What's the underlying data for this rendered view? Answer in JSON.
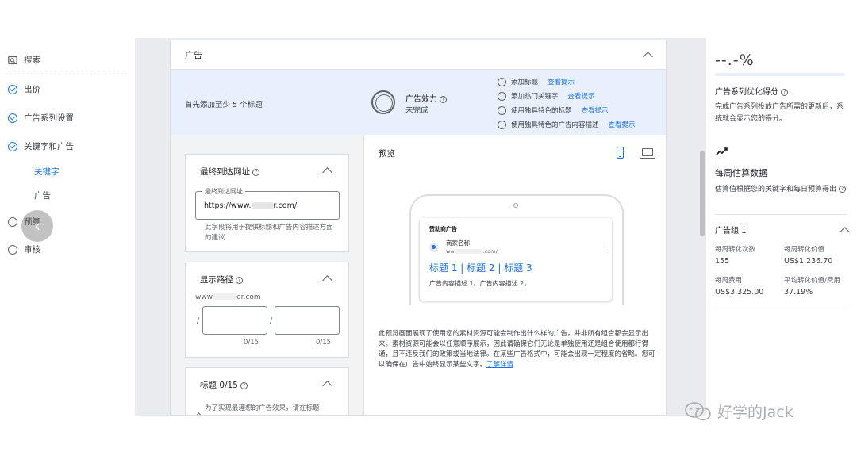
{
  "nav": {
    "search": "搜索",
    "bidding": "出价",
    "campaign_settings": "广告系列设置",
    "keywords_ads": "关键字和广告",
    "keywords": "关键字",
    "ads": "广告",
    "budget": "预算",
    "review": "审核"
  },
  "card": {
    "title": "广告",
    "banner_text": "首先添加至少 5 个标题",
    "ad_strength_label": "广告效力",
    "ad_strength_status": "未完成",
    "tips": [
      {
        "text": "添加标题",
        "link": "查看提示"
      },
      {
        "text": "添加热门关键字",
        "link": "查看提示"
      },
      {
        "text": "使用独具特色的标题",
        "link": "查看提示"
      },
      {
        "text": "使用独具特色的广告内容描述",
        "link": "查看提示"
      }
    ]
  },
  "form": {
    "final_url_title": "最终到达网址",
    "final_url_label": "最终到达网址",
    "final_url_prefix": "https://www.",
    "final_url_suffix": "r.com/",
    "final_url_hint": "此字段将用于提供标题和广告内容描述方面的建议",
    "display_path_title": "显示路径",
    "display_domain_prefix": "www",
    "display_domain_suffix": "er.com",
    "path_slash": "/",
    "path1_count": "0/15",
    "path2_count": "0/15",
    "headline_title": "标题 0/15",
    "headline_hint": "为了实现最理想的广告效果，请在标题"
  },
  "preview": {
    "title": "预览",
    "sponsored": "赞助商广告",
    "business_name": "商家名称",
    "display_url_prefix": "ww",
    "display_url_suffix": ".com/",
    "headline": "标题 1 | 标题 2 | 标题 3",
    "description": "广告内容描述 1。广告内容描述 2。",
    "note": "此预览画面展现了使用您的素材资源可能会制作出什么样的广告，并非所有组合都会显示出来。素材资源可能会以任意顺序展示，因此请确保它们无论是单独使用还是组合使用都行得通，且不违反我们的政策或当地法律。在某些广告格式中，可能会出现一定程度的省略。您可以确保在广告中始终显示某些文字。",
    "learn_more": "了解详情"
  },
  "right": {
    "score": "--.-%",
    "opt_title": "广告系列优化得分",
    "opt_text": "完成广告系列投放广告所需的更新后，系统就会显示您的得分。",
    "weekly_title": "每周估算数据",
    "weekly_text": "估算值根据您的关键字和每日预算得出",
    "ad_group": "广告组 1",
    "stats": [
      {
        "label": "每周转化次数",
        "value": "155"
      },
      {
        "label": "每周转化价值",
        "value": "US$1,236.70"
      },
      {
        "label": "每周费用",
        "value": "US$3,325.00"
      },
      {
        "label": "平均转化价值/费用",
        "value": "37.19%"
      }
    ]
  },
  "watermark": "好学的Jack"
}
